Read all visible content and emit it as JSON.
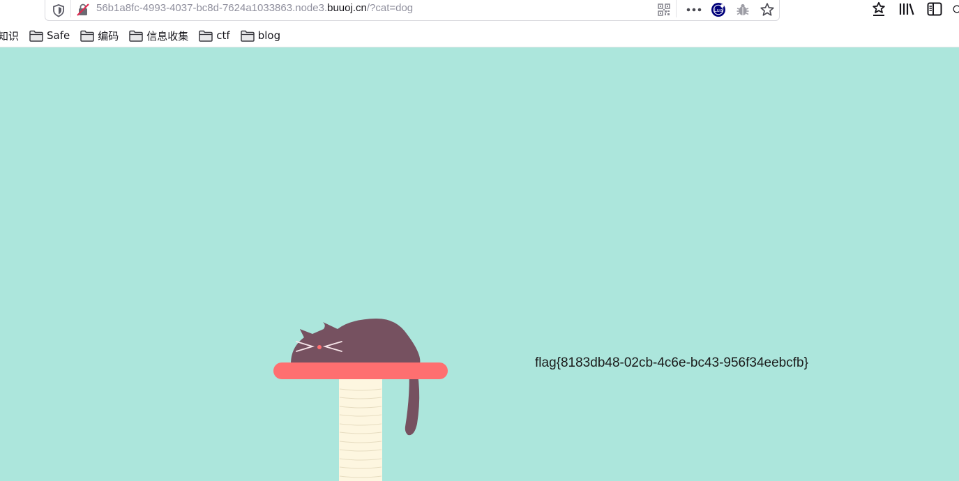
{
  "browser": {
    "url": {
      "prefix": "56b1a8fc-4993-4037-bc8d-7624a1033863.node3.",
      "domain": "buuoj.cn",
      "suffix": "/?cat=dog"
    },
    "url_icons": [
      "qr-code-icon",
      "more-dots-icon",
      "lua-extension-icon",
      "bug-icon",
      "bookmark-star-icon"
    ],
    "toolbar_icons": [
      "reading-list-icon",
      "library-icon",
      "sidebar-icon"
    ],
    "bookmarks": {
      "first_label": "知识",
      "items": [
        {
          "label": "Safe",
          "icon": "folder-icon"
        },
        {
          "label": "编码",
          "icon": "folder-icon"
        },
        {
          "label": "信息收集",
          "icon": "folder-icon"
        },
        {
          "label": "ctf",
          "icon": "folder-icon"
        },
        {
          "label": "blog",
          "icon": "folder-icon"
        }
      ]
    },
    "lua_badge": "Lua"
  },
  "page": {
    "background_color": "#ace6dc",
    "flag_text": "flag{8183db48-02cb-4c6e-bc43-956f34eebcfb}",
    "illustration": {
      "subject": "sleeping-cat-on-scratching-post",
      "cat_color": "#765160",
      "platform_color": "#fe6f70",
      "post_color": "#fdf6e0"
    }
  }
}
